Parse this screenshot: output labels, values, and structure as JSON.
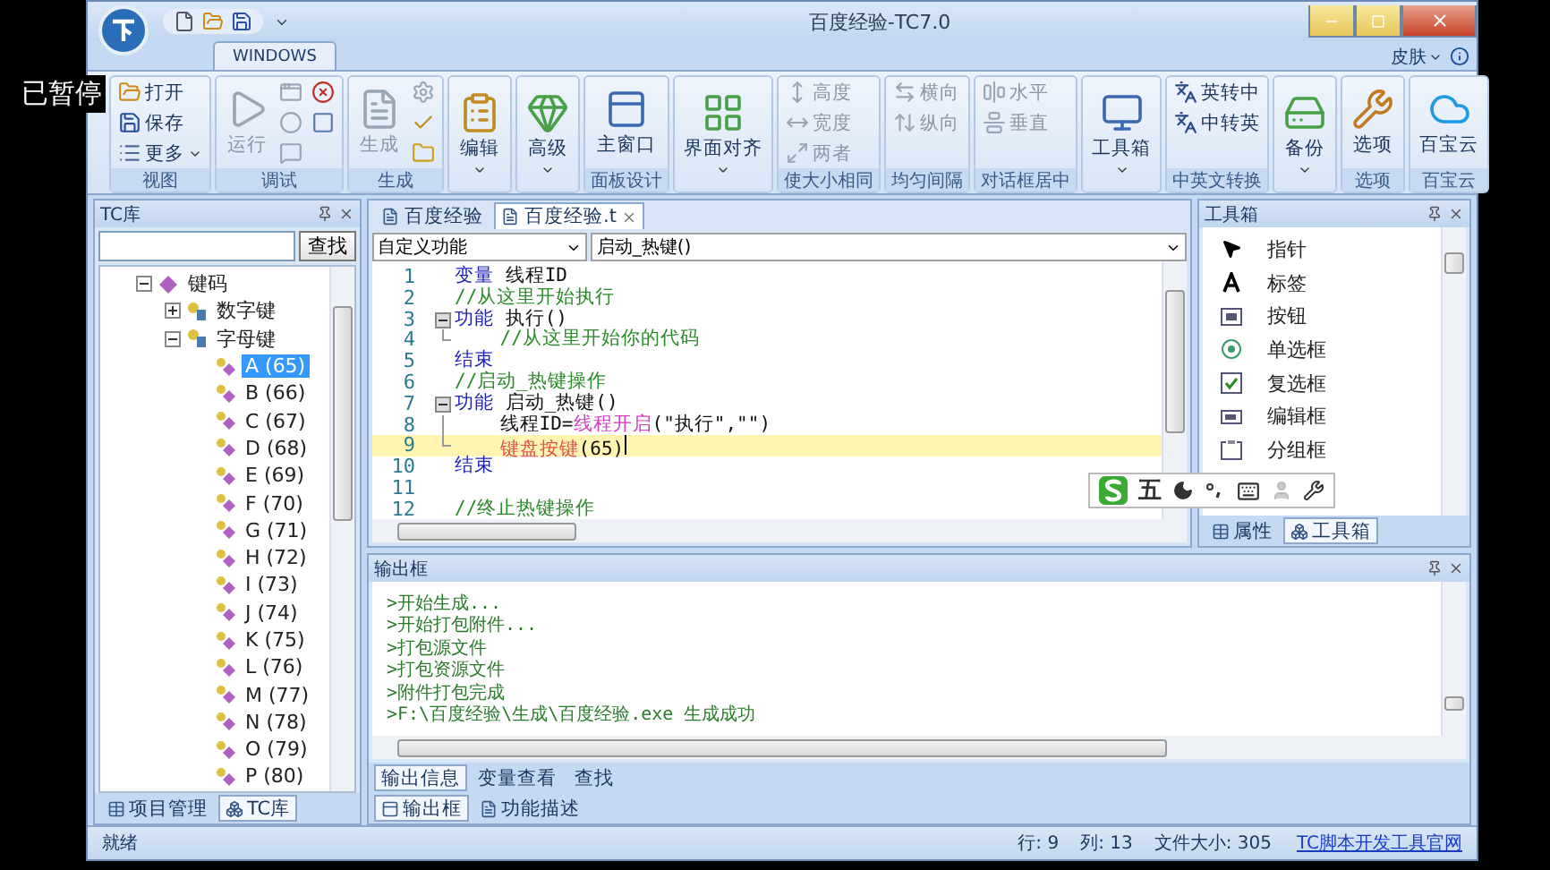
{
  "overlay": {
    "text": "已暂停"
  },
  "window": {
    "title": "百度经验-TC7.0"
  },
  "ribbon_tabs": [
    {
      "label": "WINDOWS",
      "selected": true
    }
  ],
  "skin_menu": {
    "label": "皮肤"
  },
  "ribbon": {
    "groups": [
      {
        "label": "视图",
        "buttons": [
          {
            "kind": "small",
            "label": "打开",
            "disabled": false,
            "dropdown": false
          },
          {
            "kind": "small",
            "label": "保存",
            "disabled": false,
            "dropdown": false
          },
          {
            "kind": "small",
            "label": "更多",
            "disabled": false,
            "dropdown": true
          }
        ]
      },
      {
        "label": "调试",
        "buttons": [
          {
            "kind": "large",
            "label": "运行",
            "disabled": true,
            "dropdown": false
          },
          {
            "kind": "small",
            "disabled": true,
            "dropdown": false
          },
          {
            "kind": "small",
            "disabled": true,
            "dropdown": false
          },
          {
            "kind": "small",
            "disabled": true,
            "dropdown": false
          },
          {
            "kind": "small",
            "disabled": false,
            "dropdown": false
          },
          {
            "kind": "small",
            "disabled": false,
            "dropdown": false
          }
        ]
      },
      {
        "label": "生成",
        "buttons": [
          {
            "kind": "large",
            "label": "生成",
            "disabled": true,
            "dropdown": false
          },
          {
            "kind": "small",
            "disabled": true,
            "dropdown": false
          },
          {
            "kind": "small",
            "disabled": false,
            "dropdown": false
          },
          {
            "kind": "small",
            "disabled": false,
            "dropdown": false
          }
        ]
      },
      {
        "buttons": [
          {
            "kind": "large",
            "label": "编辑",
            "disabled": false,
            "dropdown": true
          }
        ]
      },
      {
        "buttons": [
          {
            "kind": "large",
            "label": "高级",
            "disabled": false,
            "dropdown": true
          }
        ]
      },
      {
        "label": "面板设计",
        "buttons": [
          {
            "kind": "large",
            "label": "主窗口",
            "disabled": false,
            "dropdown": false
          }
        ]
      },
      {
        "buttons": [
          {
            "kind": "large",
            "label": "界面对齐",
            "disabled": false,
            "dropdown": true
          }
        ]
      },
      {
        "label": "使大小相同",
        "buttons": [
          {
            "kind": "small",
            "label": "高度",
            "disabled": true,
            "dropdown": false
          },
          {
            "kind": "small",
            "label": "宽度",
            "disabled": true,
            "dropdown": false
          },
          {
            "kind": "small",
            "label": "两者",
            "disabled": true,
            "dropdown": false
          }
        ]
      },
      {
        "label": "均匀间隔",
        "buttons": [
          {
            "kind": "small",
            "label": "横向",
            "disabled": true,
            "dropdown": false
          },
          {
            "kind": "small",
            "label": "纵向",
            "disabled": true,
            "dropdown": false
          }
        ]
      },
      {
        "label": "对话框居中",
        "buttons": [
          {
            "kind": "small",
            "label": "水平",
            "disabled": true,
            "dropdown": false
          },
          {
            "kind": "small",
            "label": "垂直",
            "disabled": true,
            "dropdown": false
          }
        ]
      },
      {
        "buttons": [
          {
            "kind": "large",
            "label": "工具箱",
            "disabled": false,
            "dropdown": true
          }
        ]
      },
      {
        "label": "中英文转换",
        "buttons": [
          {
            "kind": "small",
            "label": "英转中",
            "disabled": false,
            "dropdown": false
          },
          {
            "kind": "small",
            "label": "中转英",
            "disabled": false,
            "dropdown": false
          }
        ]
      },
      {
        "buttons": [
          {
            "kind": "large",
            "label": "备份",
            "disabled": false,
            "dropdown": true
          }
        ]
      },
      {
        "label": "选项",
        "buttons": [
          {
            "kind": "large",
            "label": "选项",
            "disabled": false,
            "dropdown": false
          }
        ]
      },
      {
        "label": "百宝云",
        "buttons": [
          {
            "kind": "large",
            "label": "百宝云",
            "disabled": false,
            "dropdown": false
          }
        ]
      }
    ]
  },
  "library_panel": {
    "title": "TC库",
    "search_button": "查找",
    "tree": [
      {
        "kind": "category",
        "label": "键码",
        "selected": false,
        "expanded": true,
        "children": [
          {
            "kind": "group",
            "label": "数字键",
            "selected": false,
            "expanded": false
          },
          {
            "kind": "group",
            "label": "字母键",
            "selected": false,
            "expanded": true,
            "children": [
              {
                "kind": "key",
                "label": "A (65)",
                "selected": true
              },
              {
                "kind": "key",
                "label": "B (66)",
                "selected": false
              },
              {
                "kind": "key",
                "label": "C (67)",
                "selected": false
              },
              {
                "kind": "key",
                "label": "D (68)",
                "selected": false
              },
              {
                "kind": "key",
                "label": "E (69)",
                "selected": false
              },
              {
                "kind": "key",
                "label": "F (70)",
                "selected": false
              },
              {
                "kind": "key",
                "label": "G (71)",
                "selected": false
              },
              {
                "kind": "key",
                "label": "H (72)",
                "selected": false
              },
              {
                "kind": "key",
                "label": "I (73)",
                "selected": false
              },
              {
                "kind": "key",
                "label": "J (74)",
                "selected": false
              },
              {
                "kind": "key",
                "label": "K (75)",
                "selected": false
              },
              {
                "kind": "key",
                "label": "L (76)",
                "selected": false
              },
              {
                "kind": "key",
                "label": "M (77)",
                "selected": false
              },
              {
                "kind": "key",
                "label": "N (78)",
                "selected": false
              },
              {
                "kind": "key",
                "label": "O (79)",
                "selected": false
              },
              {
                "kind": "key",
                "label": "P (80)",
                "selected": false
              }
            ]
          }
        ]
      }
    ],
    "tabs": [
      {
        "label": "项目管理",
        "selected": false
      },
      {
        "label": "TC库",
        "selected": true
      }
    ]
  },
  "editor": {
    "doc_tabs": [
      {
        "label": "百度经验",
        "selected": false,
        "closable": false
      },
      {
        "label": "百度经验.t",
        "selected": true,
        "closable": true
      }
    ],
    "scope_select": "自定义功能",
    "function_select": "启动_热键()",
    "lines": [
      {
        "number": "1",
        "current": false,
        "kind": "plain",
        "segments": [
          {
            "kind": "keyword",
            "text": "变量"
          },
          {
            "kind": "plain",
            "text": " 线程ID"
          }
        ]
      },
      {
        "number": "2",
        "current": false,
        "kind": "plain",
        "segments": [
          {
            "kind": "comment",
            "text": "//从这里开始执行"
          }
        ]
      },
      {
        "number": "3",
        "current": false,
        "kind": "foldstart",
        "segments": [
          {
            "kind": "keyword",
            "text": "功能"
          },
          {
            "kind": "plain",
            "text": " 执行()"
          }
        ]
      },
      {
        "number": "4",
        "current": false,
        "kind": "foldend",
        "segments": [
          {
            "kind": "comment",
            "text": "    //从这里开始你的代码"
          }
        ]
      },
      {
        "number": "5",
        "current": false,
        "kind": "plain",
        "segments": [
          {
            "kind": "keyword",
            "text": "结束"
          }
        ]
      },
      {
        "number": "6",
        "current": false,
        "kind": "plain",
        "segments": [
          {
            "kind": "comment",
            "text": "//启动_热键操作"
          }
        ]
      },
      {
        "number": "7",
        "current": false,
        "kind": "foldstart",
        "segments": [
          {
            "kind": "keyword",
            "text": "功能"
          },
          {
            "kind": "plain",
            "text": " 启动_热键()"
          }
        ]
      },
      {
        "number": "8",
        "current": false,
        "kind": "foldbody",
        "segments": [
          {
            "kind": "plain",
            "text": "    线程ID="
          },
          {
            "kind": "function",
            "text": "线程开启"
          },
          {
            "kind": "plain",
            "text": "(\"执行\",\"\")"
          }
        ]
      },
      {
        "number": "9",
        "current": true,
        "kind": "foldend",
        "segments": [
          {
            "kind": "builtin",
            "text": "    键盘按键"
          },
          {
            "kind": "plain",
            "text": "(65)"
          }
        ]
      },
      {
        "number": "10",
        "current": false,
        "kind": "plain",
        "segments": [
          {
            "kind": "keyword",
            "text": "结束"
          }
        ]
      },
      {
        "number": "11",
        "current": false,
        "kind": "plain"
      },
      {
        "number": "12",
        "current": false,
        "kind": "plain",
        "segments": [
          {
            "kind": "comment",
            "text": "//终止热键操作"
          }
        ]
      }
    ]
  },
  "toolbox_panel": {
    "title": "工具箱",
    "items": [
      {
        "kind": "pointer",
        "label": "指针"
      },
      {
        "kind": "label",
        "label": "标签"
      },
      {
        "kind": "button",
        "label": "按钮"
      },
      {
        "kind": "radio",
        "label": "单选框"
      },
      {
        "kind": "checkbox",
        "label": "复选框"
      },
      {
        "kind": "edit",
        "label": "编辑框"
      },
      {
        "kind": "group",
        "label": "分组框"
      }
    ],
    "tabs": [
      {
        "label": "属性",
        "selected": false
      },
      {
        "label": "工具箱",
        "selected": true
      }
    ]
  },
  "ime_bar": {
    "mode": "五"
  },
  "output_panel": {
    "title": "输出框",
    "lines": [
      ">开始生成...",
      ">开始打包附件...",
      ">打包源文件",
      ">打包资源文件",
      ">附件打包完成",
      ">F:\\百度经验\\生成\\百度经验.exe 生成成功"
    ],
    "tabs": [
      {
        "label": "输出信息",
        "selected": true
      },
      {
        "label": "变量查看",
        "selected": false
      },
      {
        "label": "查找",
        "selected": false
      }
    ],
    "bottom_tabs": [
      {
        "label": "输出框",
        "selected": true
      },
      {
        "label": "功能描述",
        "selected": false
      }
    ]
  },
  "status_bar": {
    "text": "就绪",
    "cells": [
      "行: 9",
      "列: 13",
      "文件大小: 305"
    ],
    "link": "TC脚本开发工具官网"
  }
}
